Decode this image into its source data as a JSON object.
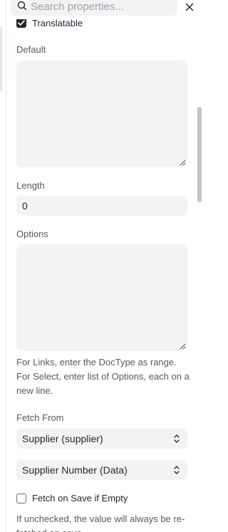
{
  "search": {
    "placeholder": "Search properties..."
  },
  "translatable": {
    "label": "Translatable",
    "checked": true
  },
  "default_field": {
    "label": "Default",
    "value": ""
  },
  "length_field": {
    "label": "Length",
    "value": "0"
  },
  "options_field": {
    "label": "Options",
    "value": "",
    "help": "For Links, enter the DocType as range. For Select, enter list of Options, each on a new line."
  },
  "fetch_from": {
    "label": "Fetch From",
    "source_value": "Supplier (supplier)",
    "field_value": "Supplier Number (Data)"
  },
  "fetch_if_empty": {
    "label": "Fetch on Save if Empty",
    "checked": false,
    "help": "If unchecked, the value will always be re-fetched on save."
  },
  "colors": {
    "field_bg": "#f3f3f3",
    "text": "#1f272e",
    "muted": "#525a63"
  }
}
